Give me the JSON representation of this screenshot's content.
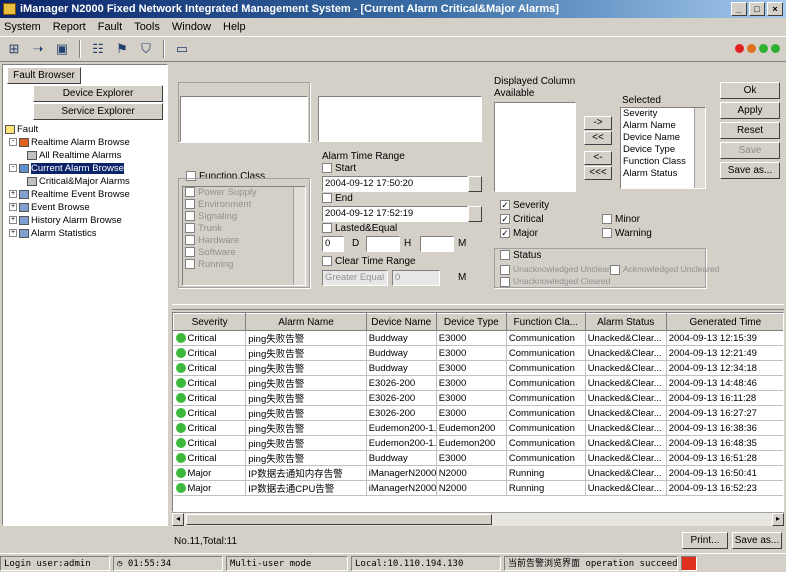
{
  "window": {
    "title": "iManager N2000 Fixed Network Integrated Management System - [Current Alarm Critical&Major Alarms]"
  },
  "menu": [
    {
      "label": "System"
    },
    {
      "label": "Report"
    },
    {
      "label": "Fault"
    },
    {
      "label": "Tools"
    },
    {
      "label": "Window"
    },
    {
      "label": "Help"
    }
  ],
  "left": {
    "top_buttons": {
      "fault": "Fault Browser",
      "device": "Device Explorer",
      "service": "Service Explorer"
    },
    "tree": [
      {
        "label": "Fault",
        "indent": 0
      },
      {
        "label": "Realtime Alarm Browse",
        "indent": 1
      },
      {
        "label": "All Realtime Alarms",
        "indent": 2
      },
      {
        "label": "Current Alarm Browse",
        "indent": 1,
        "selected": true
      },
      {
        "label": "Critical&Major Alarms",
        "indent": 2
      },
      {
        "label": "Realtime Event Browse",
        "indent": 1
      },
      {
        "label": "Event Browse",
        "indent": 1
      },
      {
        "label": "History Alarm Browse",
        "indent": 1
      },
      {
        "label": "Alarm Statistics",
        "indent": 1
      }
    ]
  },
  "filters": {
    "function_class_label": "Function Class",
    "function_class_items": [
      "Power Supply",
      "Environment",
      "Signaling",
      "Trunk",
      "Hardware",
      "Software",
      "Running"
    ],
    "alarm_time_range_label": "Alarm Time Range",
    "start_label": "Start",
    "start_value": "2004-09-12 17:50:20",
    "end_label": "End",
    "end_value": "2004-09-12 17:52:19",
    "lasted_label": "Lasted&Equal",
    "lasted_d": "0",
    "lasted_d_unit": "D",
    "lasted_h": "",
    "lasted_h_unit": "H",
    "lasted_m_unit": "M",
    "clear_time_label": "Clear Time Range",
    "clear_time_select": "Greater Equal",
    "clear_time_value": "0"
  },
  "display_columns": {
    "title": "Displayed Column",
    "available_label": "Available",
    "selected_label": "Selected",
    "selected_items": [
      "Severity",
      "Alarm Name",
      "Device Name",
      "Device Type",
      "Function Class",
      "Alarm Status"
    ],
    "move_buttons": [
      "->",
      "<<",
      "<-",
      "<<<"
    ]
  },
  "severity_options": {
    "severity_label": "Severity",
    "critical": "Critical",
    "minor": "Minor",
    "major": "Major",
    "warning": "Warning",
    "status_label": "Status",
    "status_opt1": "Unacknowledged Uncleared",
    "status_opt2": "Acknowledged Uncleared",
    "status_opt3": "Unacknowledged Cleared"
  },
  "action_buttons": {
    "ok": "Ok",
    "apply": "Apply",
    "reset": "Reset",
    "save": "Save",
    "save_as": "Save as..."
  },
  "table": {
    "columns": [
      "Severity",
      "Alarm Name",
      "Device Name",
      "Device Type",
      "Function Cla...",
      "Alarm Status",
      "Generated Time"
    ],
    "rows": [
      {
        "sev": "Critical",
        "name": "ping失败告警",
        "device": "Buddway",
        "type": "E3000",
        "fc": "Communication",
        "status": "Unacked&Clear...",
        "time": "2004-09-13 12:15:39",
        "color": "#3cb83c"
      },
      {
        "sev": "Critical",
        "name": "ping失败告警",
        "device": "Buddway",
        "type": "E3000",
        "fc": "Communication",
        "status": "Unacked&Clear...",
        "time": "2004-09-13 12:21:49",
        "color": "#3cb83c"
      },
      {
        "sev": "Critical",
        "name": "ping失败告警",
        "device": "Buddway",
        "type": "E3000",
        "fc": "Communication",
        "status": "Unacked&Clear...",
        "time": "2004-09-13 12:34:18",
        "color": "#3cb83c"
      },
      {
        "sev": "Critical",
        "name": "ping失败告警",
        "device": "E3026-200",
        "type": "E3000",
        "fc": "Communication",
        "status": "Unacked&Clear...",
        "time": "2004-09-13 14:48:46",
        "color": "#3cb83c"
      },
      {
        "sev": "Critical",
        "name": "ping失败告警",
        "device": "E3026-200",
        "type": "E3000",
        "fc": "Communication",
        "status": "Unacked&Clear...",
        "time": "2004-09-13 16:11:28",
        "color": "#3cb83c"
      },
      {
        "sev": "Critical",
        "name": "ping失败告警",
        "device": "E3026-200",
        "type": "E3000",
        "fc": "Communication",
        "status": "Unacked&Clear...",
        "time": "2004-09-13 16:27:27",
        "color": "#3cb83c"
      },
      {
        "sev": "Critical",
        "name": "ping失败告警",
        "device": "Eudemon200-1...",
        "type": "Eudemon200",
        "fc": "Communication",
        "status": "Unacked&Clear...",
        "time": "2004-09-13 16:38:36",
        "color": "#3cb83c"
      },
      {
        "sev": "Critical",
        "name": "ping失败告警",
        "device": "Eudemon200-1...",
        "type": "Eudemon200",
        "fc": "Communication",
        "status": "Unacked&Clear...",
        "time": "2004-09-13 16:48:35",
        "color": "#3cb83c"
      },
      {
        "sev": "Critical",
        "name": "ping失败告警",
        "device": "Buddway",
        "type": "E3000",
        "fc": "Communication",
        "status": "Unacked&Clear...",
        "time": "2004-09-13 16:51:28",
        "color": "#3cb83c"
      },
      {
        "sev": "Major",
        "name": "IP数据去通知内存告警",
        "device": "iManagerN2000",
        "type": "N2000",
        "fc": "Running",
        "status": "Unacked&Clear...",
        "time": "2004-09-13 16:50:41",
        "color": "#3cb83c"
      },
      {
        "sev": "Major",
        "name": "IP数据去通CPU告警",
        "device": "iManagerN2000",
        "type": "N2000",
        "fc": "Running",
        "status": "Unacked&Clear...",
        "time": "2004-09-13 16:52:23",
        "color": "#3cb83c"
      }
    ]
  },
  "bottom": {
    "count_text": "No.11,Total:11",
    "print_label": "Print...",
    "save_as_label": "Save as..."
  },
  "statusbar": {
    "app": "Login user:admin",
    "time": "01:55:34",
    "mode": "Multi-user mode",
    "server": "Local:10.110.194.130",
    "message_cn": "当前告警浏览界面",
    "message": "operation succeeded."
  },
  "colors": {
    "critical": "#3cb83c",
    "accent": "#0a246a"
  }
}
